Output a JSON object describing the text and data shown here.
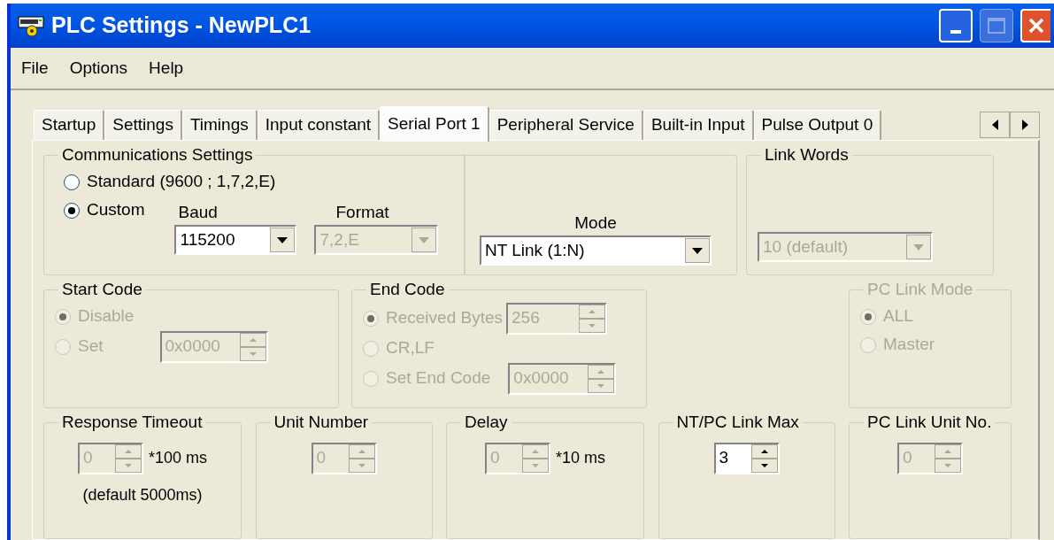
{
  "window": {
    "title": "PLC Settings - NewPLC1"
  },
  "menu": [
    "File",
    "Options",
    "Help"
  ],
  "tabs": [
    {
      "label": "Startup",
      "selected": false
    },
    {
      "label": "Settings",
      "selected": false
    },
    {
      "label": "Timings",
      "selected": false
    },
    {
      "label": "Input constant",
      "selected": false
    },
    {
      "label": "Serial Port 1",
      "selected": true
    },
    {
      "label": "Peripheral Service",
      "selected": false
    },
    {
      "label": "Built-in Input",
      "selected": false
    },
    {
      "label": "Pulse Output 0",
      "selected": false
    }
  ],
  "communications_settings": {
    "title": "Communications Settings",
    "options": [
      {
        "label": "Standard (9600 ; 1,7,2,E)",
        "selected": false
      },
      {
        "label": "Custom",
        "selected": true
      }
    ],
    "baud": {
      "label": "Baud",
      "value": "115200",
      "disabled": false
    },
    "format": {
      "label": "Format",
      "value": "7,2,E",
      "disabled": true
    },
    "mode": {
      "label": "Mode",
      "value": "NT Link (1:N)",
      "disabled": false
    }
  },
  "link_words": {
    "title": "Link Words",
    "value": "10 (default)",
    "disabled": true
  },
  "start_code": {
    "title": "Start Code",
    "disabled": false,
    "options": [
      {
        "label": "Disable",
        "selected": true,
        "disabled": true
      },
      {
        "label": "Set",
        "selected": false,
        "disabled": true,
        "value": "0x0000"
      }
    ]
  },
  "end_code": {
    "title": "End Code",
    "disabled": false,
    "options": [
      {
        "label": "Received Bytes",
        "selected": true,
        "disabled": true,
        "value": "256"
      },
      {
        "label": "CR,LF",
        "selected": false,
        "disabled": true
      },
      {
        "label": "Set End Code",
        "selected": false,
        "disabled": true,
        "value": "0x0000"
      }
    ]
  },
  "pc_link_mode": {
    "title": "PC Link Mode",
    "disabled": true,
    "options": [
      {
        "label": "ALL",
        "selected": true,
        "disabled": true
      },
      {
        "label": "Master",
        "selected": false,
        "disabled": true
      }
    ]
  },
  "bottom_groups": [
    {
      "title": "Response Timeout",
      "value": "0",
      "disabled": true,
      "unit": "*100 ms",
      "note": "(default 5000ms)"
    },
    {
      "title": "Unit Number",
      "value": "0",
      "disabled": true
    },
    {
      "title": "Delay",
      "value": "0",
      "disabled": true,
      "unit": "*10 ms"
    },
    {
      "title": "NT/PC Link Max",
      "value": "3",
      "disabled": false
    },
    {
      "title": "PC Link Unit No.",
      "value": "0",
      "disabled": true
    }
  ]
}
